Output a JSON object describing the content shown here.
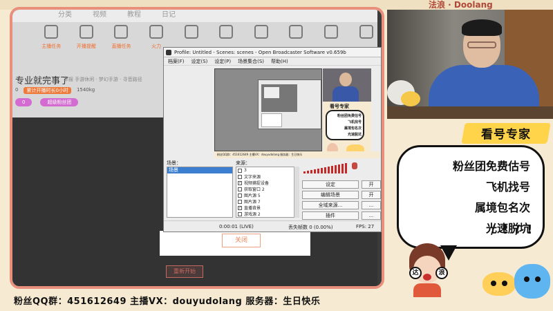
{
  "top_brand": "法浪 · Doolang",
  "background_page": {
    "tabs": [
      "",
      "分类",
      "视频",
      "教程",
      "日记"
    ],
    "toolbar_labels": [
      "主播任务",
      "开播提醒",
      "直播任务",
      "火力",
      "",
      "",
      "",
      "",
      "",
      ""
    ],
    "heading": "专业就完事了",
    "meta": "举报  手游休闲 · 梦幻手游 · 寻音路径",
    "stats": [
      "0",
      "累计开播时长0小时",
      "1540kg"
    ],
    "actions": [
      "0",
      "超级粉丝团"
    ],
    "dialog_button": "关闭",
    "restart_button": "重新开始"
  },
  "obs": {
    "title": "Profile: Untitled - Scenes: scenes - Open Broadcaster Software v0.659b",
    "menu": [
      "档案(F)",
      "设定(S)",
      "设定(P)",
      "场景集合(S)",
      "帮助(H)"
    ],
    "preview_strip": "粉丝QQ群：451612649    主播VX：douyudolang    服务器：生日快乐",
    "nested_card_title": "看号专家",
    "nested_card_lines": [
      "粉丝团免费估号",
      "飞机找号",
      "属境包名次",
      "光速脱坑"
    ],
    "scenes_label": "场景：",
    "sources_label": "来源：",
    "scenes": [
      "场景"
    ],
    "sources": [
      {
        "name": "3",
        "checked": false
      },
      {
        "name": "文字来源",
        "checked": false
      },
      {
        "name": "视频捕捉设备",
        "checked": true
      },
      {
        "name": "获取窗口 2",
        "checked": false
      },
      {
        "name": "图片源 5",
        "checked": false
      },
      {
        "name": "图片源 7",
        "checked": false
      },
      {
        "name": "直播背景",
        "checked": true
      },
      {
        "name": "游戏源 2",
        "checked": false
      }
    ],
    "buttons": {
      "settings": "设定",
      "edit_scene": "编辑场景",
      "global_sources": "全域来源...",
      "plugins": "插件",
      "start_cut": "开",
      "more": "..."
    },
    "status": {
      "time": "0:00:01 (LIVE)",
      "dropped": "丢失帧数 0 (0.00%)",
      "fps": "FPS: 27"
    }
  },
  "promo": {
    "title": "看号专家",
    "lines": [
      "粉丝团免费估号",
      "飞机找号",
      "属境包名次",
      "光速脱坑"
    ],
    "marks": "/ ! / !",
    "tags": [
      "达",
      "浪"
    ]
  },
  "footer": {
    "text": "粉丝QQ群：451612649    主播VX：douyudolang    服务器：生日快乐"
  },
  "colors": {
    "frame_border": "#e8907c",
    "promo_bg": "#f6ead2",
    "ribbon": "#ffd34a",
    "accent_orange": "#ef7a3a",
    "meter_red": "#c52828",
    "selected_blue": "#3c7fd0"
  }
}
